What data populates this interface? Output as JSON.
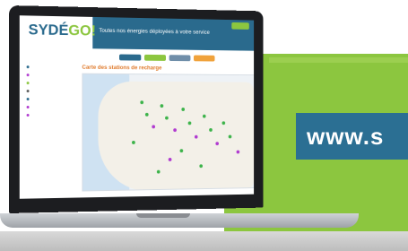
{
  "banner": {
    "text": "www.s"
  },
  "site": {
    "logo_prefix": "SYDÉ",
    "logo_suffix": "GO!",
    "tagline": "Toutes nos énergies déployées à votre service",
    "map_title": "Carte des stations de recharge"
  },
  "colors": {
    "brand_blue": "#2a6a8d",
    "brand_green": "#8cc63f",
    "nav_tab_1": "#2a6a8d",
    "nav_tab_2": "#8cc63f",
    "nav_tab_3": "#6f8ea9",
    "nav_tab_4": "#f0a23b"
  },
  "sidebar": {
    "items": [
      {
        "color": "#2a6a8d"
      },
      {
        "color": "#b03ad0"
      },
      {
        "color": "#8cc63f"
      },
      {
        "color": "#5b5b5b"
      },
      {
        "color": "#2a6a8d"
      },
      {
        "color": "#b03ad0"
      },
      {
        "color": "#b03ad0"
      }
    ]
  },
  "markers": {
    "green": "#3cb34a",
    "purple": "#b03ad0"
  }
}
